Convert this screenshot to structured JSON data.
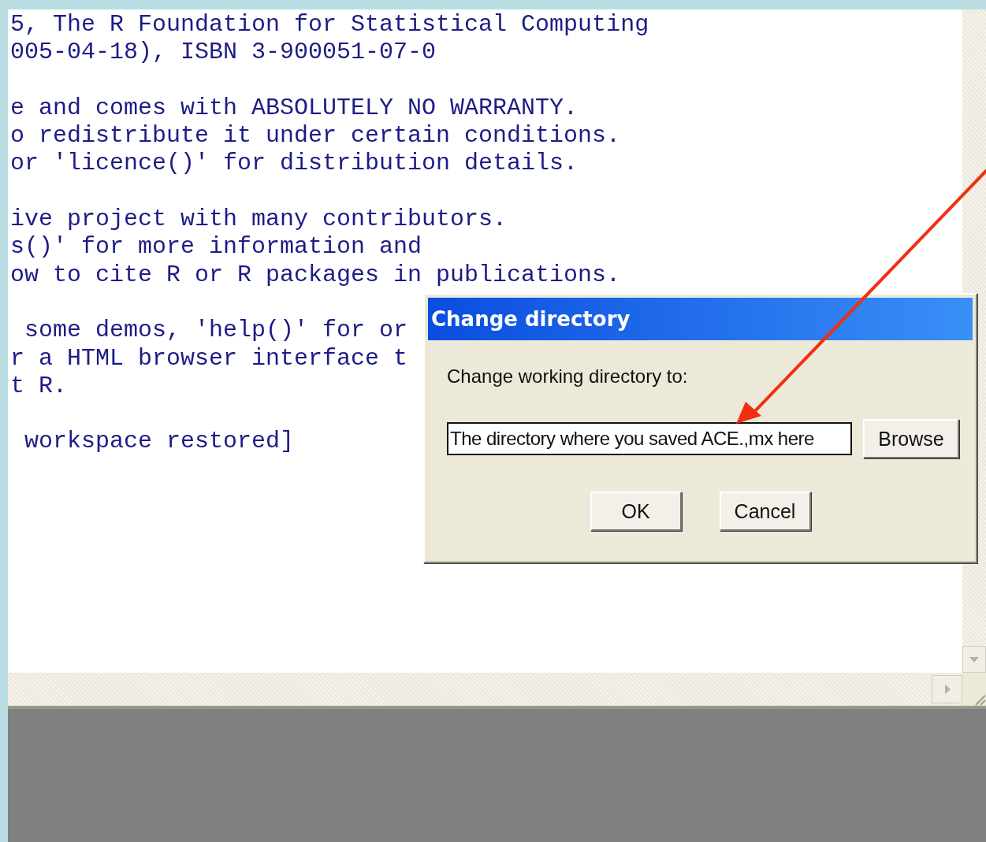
{
  "console": {
    "paragraphs": [
      [
        "5, The R Foundation for Statistical Computing",
        "005-04-18), ISBN 3-900051-07-0"
      ],
      [
        "e and comes with ABSOLUTELY NO WARRANTY.",
        "o redistribute it under certain conditions.",
        "or 'licence()' for distribution details."
      ],
      [
        "ive project with many contributors.",
        "s()' for more information and",
        "ow to cite R or R packages in publications."
      ],
      [
        " some demos, 'help()' for or",
        "r a HTML browser interface t",
        "t R."
      ],
      [
        " workspace restored]"
      ]
    ]
  },
  "dialog": {
    "title": "Change directory",
    "label": "Change working directory to:",
    "input": {
      "value": "The directory where you saved ACE.,mx here"
    },
    "browse_button": "Browse",
    "buttons": [
      "OK",
      "Cancel"
    ]
  }
}
